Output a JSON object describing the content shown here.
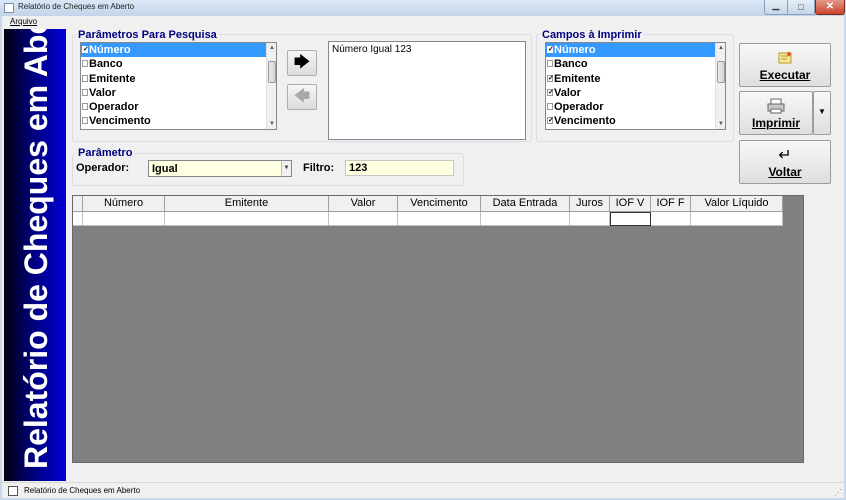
{
  "window": {
    "title": "Relatório de Cheques em Aberto",
    "close_glyph": "✕",
    "minimize_glyph": "▁",
    "maximize_glyph": "□"
  },
  "menu": {
    "items": [
      "Arquivo"
    ]
  },
  "sidebar": {
    "text": "Relatório de Cheques em Aberto"
  },
  "search_params": {
    "title": "Parâmetros Para Pesquisa",
    "items": [
      {
        "label": "Número",
        "checked": true,
        "selected": true
      },
      {
        "label": "Banco",
        "checked": false,
        "selected": false
      },
      {
        "label": "Emitente",
        "checked": false,
        "selected": false
      },
      {
        "label": "Valor",
        "checked": false,
        "selected": false
      },
      {
        "label": "Operador",
        "checked": false,
        "selected": false
      },
      {
        "label": "Vencimento",
        "checked": false,
        "selected": false
      }
    ]
  },
  "arrows": {
    "add_glyph": "🡆",
    "remove_glyph": "🡄"
  },
  "criteria_box": {
    "text": "Número Igual 123"
  },
  "print_fields": {
    "title": "Campos à Imprimir",
    "items": [
      {
        "label": "Número",
        "checked": true,
        "selected": true
      },
      {
        "label": "Banco",
        "checked": false,
        "selected": false
      },
      {
        "label": "Emitente",
        "checked": true,
        "selected": false
      },
      {
        "label": "Valor",
        "checked": true,
        "selected": false
      },
      {
        "label": "Operador",
        "checked": false,
        "selected": false
      },
      {
        "label": "Vencimento",
        "checked": true,
        "selected": false
      }
    ]
  },
  "buttons": {
    "executar": "Executar",
    "imprimir": "Imprimir",
    "voltar": "Voltar",
    "dropdown_glyph": "▼",
    "voltar_glyph": "↵"
  },
  "parametro": {
    "title": "Parâmetro",
    "operador_label": "Operador:",
    "operador_value": "Igual",
    "filtro_label": "Filtro:",
    "filtro_value": "123"
  },
  "grid": {
    "columns": [
      "Número",
      "Emitente",
      "Valor",
      "Vencimento",
      "Data Entrada",
      "Juros",
      "IOF V",
      "IOF F",
      "Valor Líquido"
    ]
  },
  "status": {
    "text": "Relatório de Cheques em Aberto"
  }
}
